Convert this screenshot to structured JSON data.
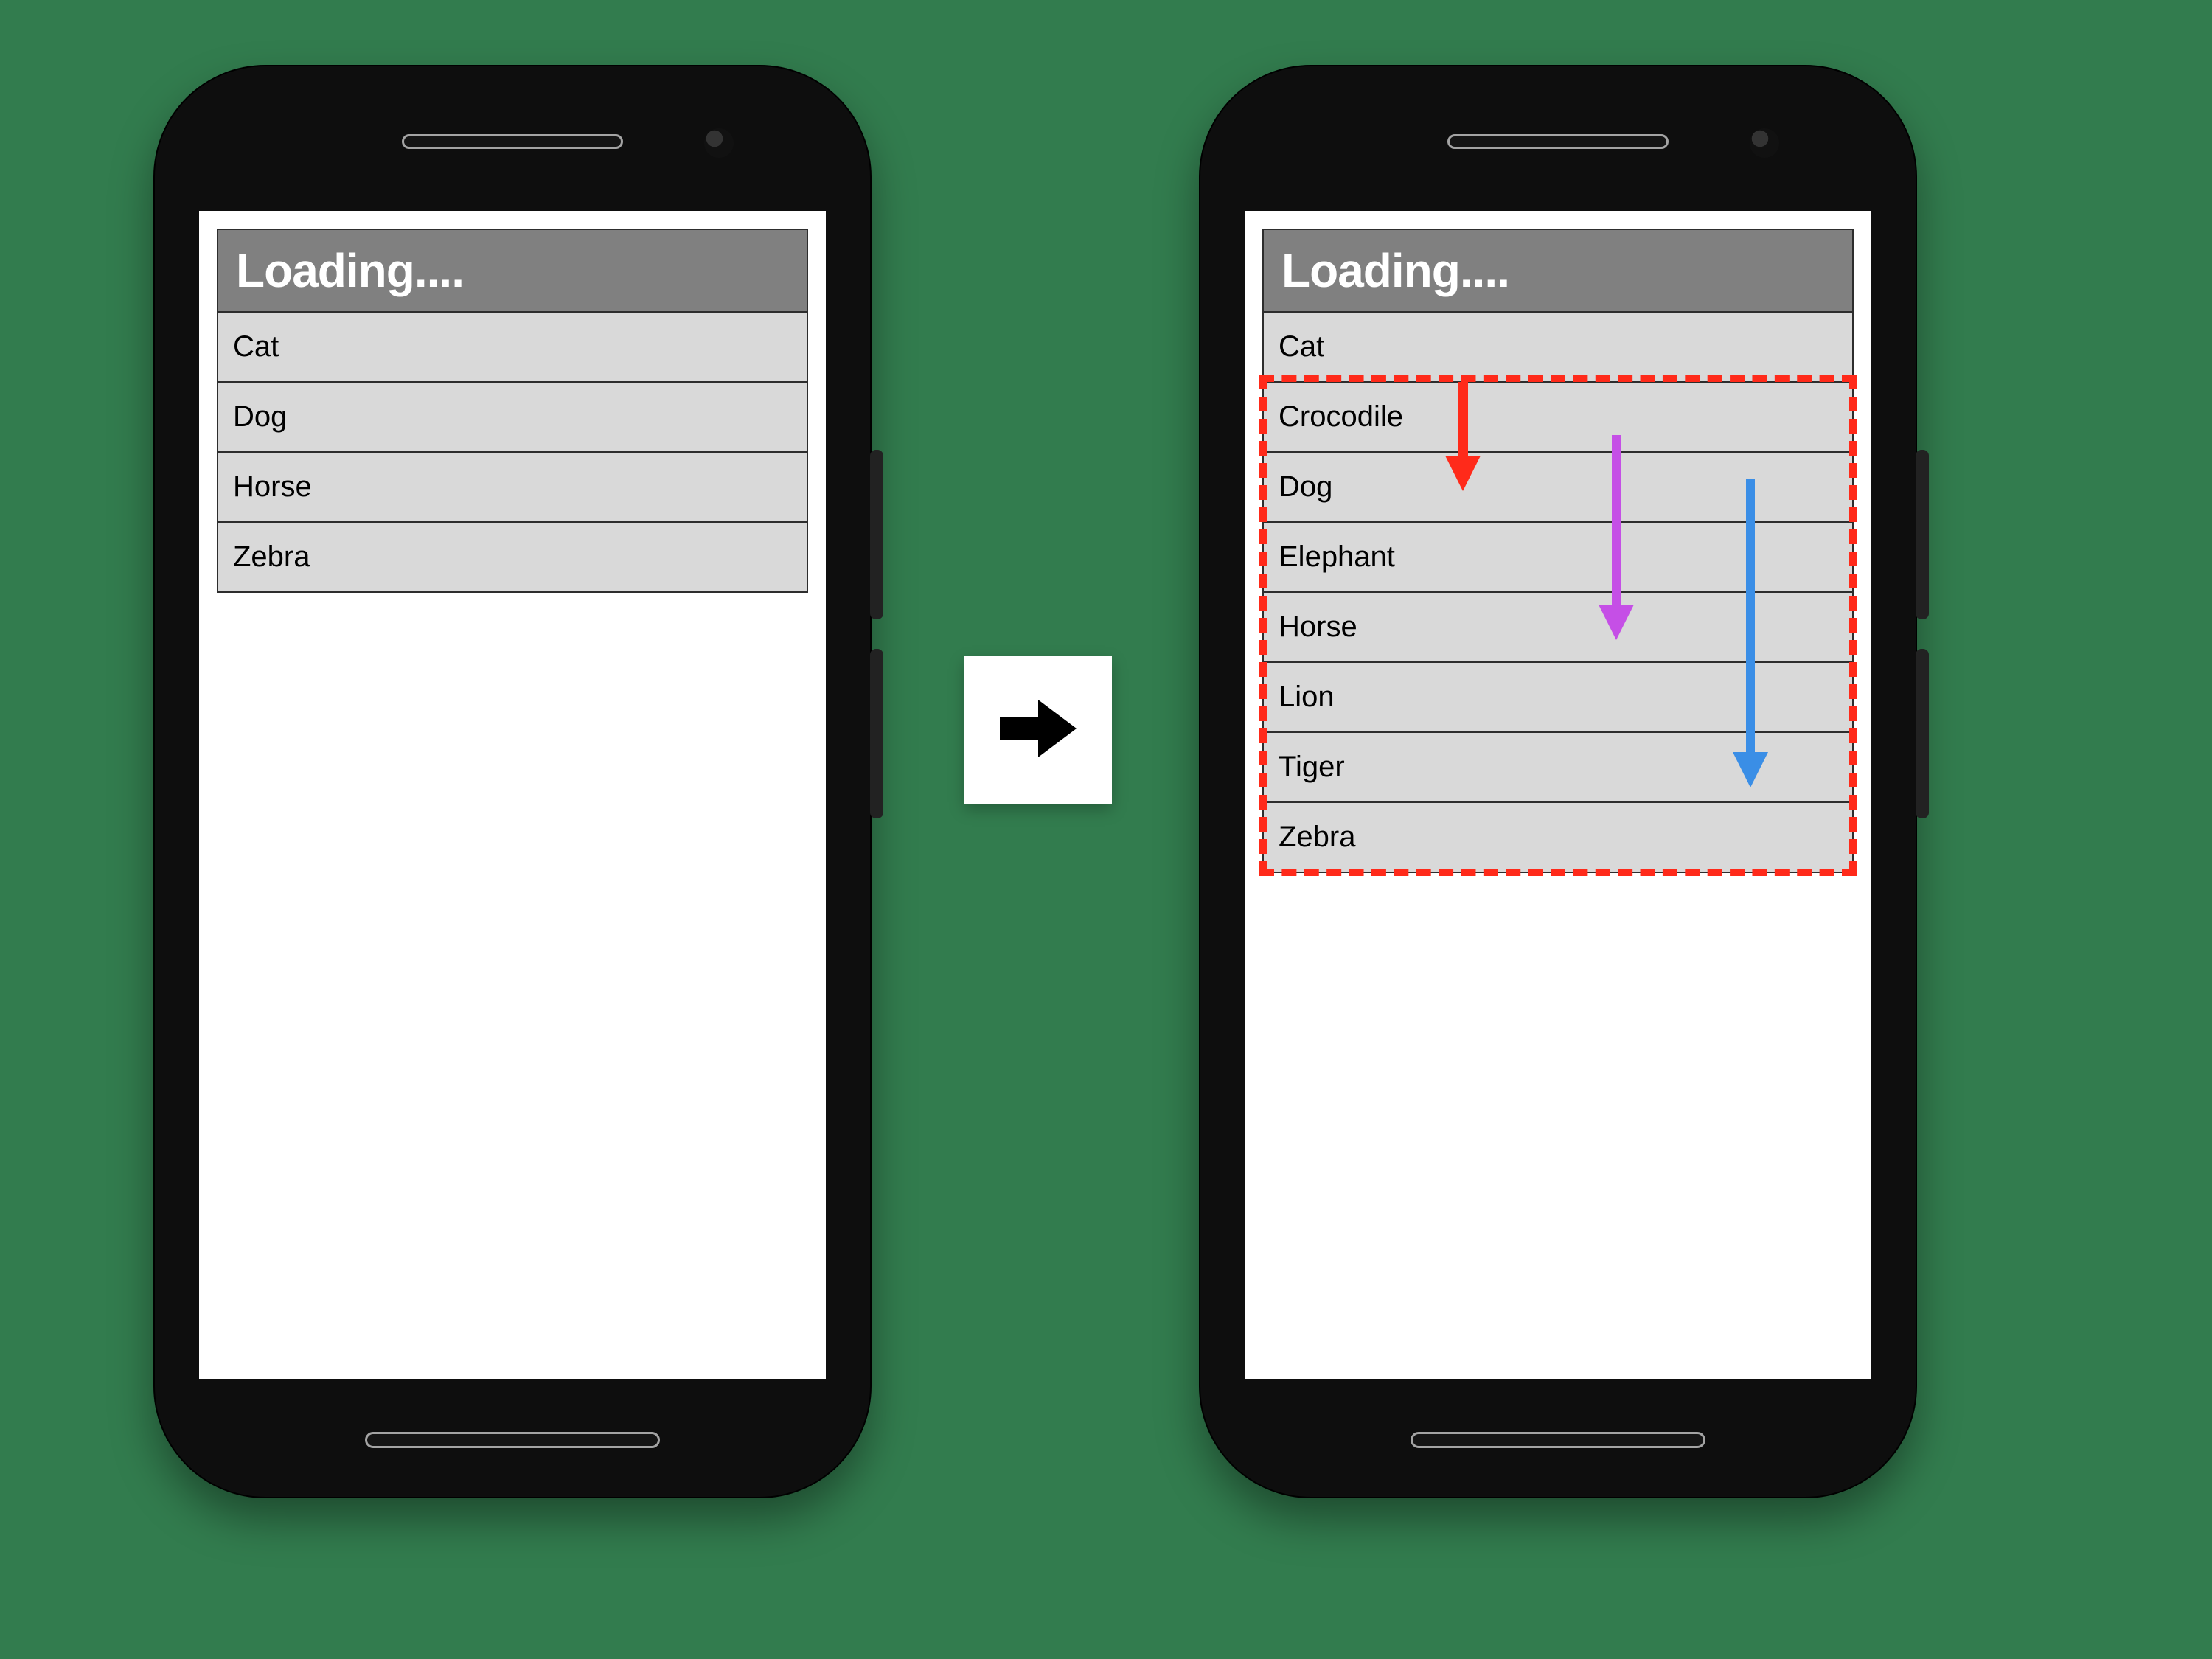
{
  "phone_left": {
    "title": "Loading....",
    "items": [
      "Cat",
      "Dog",
      "Horse",
      "Zebra"
    ]
  },
  "phone_right": {
    "title": "Loading....",
    "items": [
      "Cat",
      "Crocodile",
      "Dog",
      "Elephant",
      "Horse",
      "Lion",
      "Tiger",
      "Zebra"
    ]
  },
  "arrows": {
    "red": "#ff2a1a",
    "purple": "#c54fe6",
    "blue": "#3a8ee6"
  },
  "transition_icon": "arrow-right"
}
